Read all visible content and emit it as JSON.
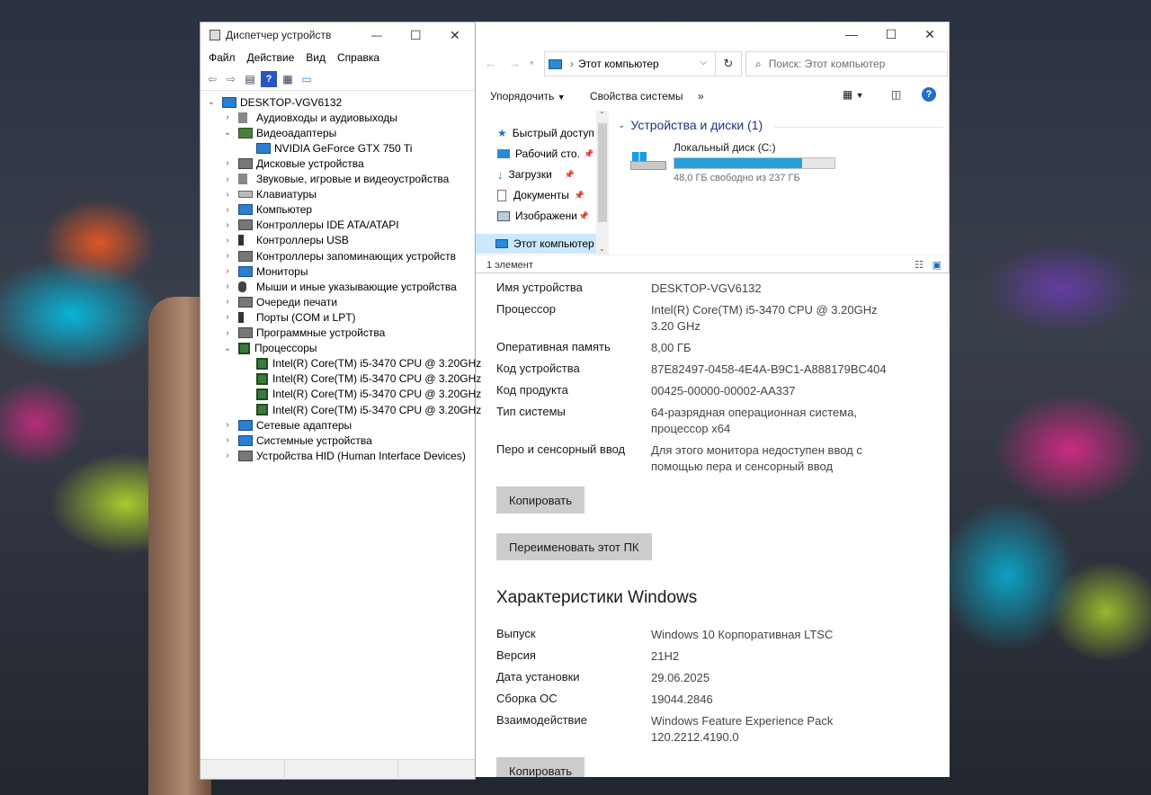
{
  "device_manager": {
    "title": "Диспетчер устройств",
    "menu": [
      "Файл",
      "Действие",
      "Вид",
      "Справка"
    ],
    "tree": [
      {
        "label": "DESKTOP-VGV6132",
        "level": 0,
        "expanded": true,
        "icon": "computer-icon"
      },
      {
        "label": "Аудиовходы и аудиовыходы",
        "level": 1,
        "expanded": false,
        "icon": "speaker-icon"
      },
      {
        "label": "Видеоадаптеры",
        "level": 1,
        "expanded": true,
        "icon": "display-adapter-icon"
      },
      {
        "label": "NVIDIA GeForce GTX 750 Ti",
        "level": 2,
        "icon": "gpu-icon"
      },
      {
        "label": "Дисковые устройства",
        "level": 1,
        "expanded": false,
        "icon": "disk-icon"
      },
      {
        "label": "Звуковые, игровые и видеоустройства",
        "level": 1,
        "expanded": false,
        "icon": "speaker-icon"
      },
      {
        "label": "Клавиатуры",
        "level": 1,
        "expanded": false,
        "icon": "keyboard-icon"
      },
      {
        "label": "Компьютер",
        "level": 1,
        "expanded": false,
        "icon": "monitor-icon"
      },
      {
        "label": "Контроллеры IDE ATA/ATAPI",
        "level": 1,
        "expanded": false,
        "icon": "controller-icon"
      },
      {
        "label": "Контроллеры USB",
        "level": 1,
        "expanded": false,
        "icon": "usb-icon"
      },
      {
        "label": "Контроллеры запоминающих устройств",
        "level": 1,
        "expanded": false,
        "icon": "storage-controller-icon"
      },
      {
        "label": "Мониторы",
        "level": 1,
        "expanded": false,
        "icon": "monitor-icon"
      },
      {
        "label": "Мыши и иные указывающие устройства",
        "level": 1,
        "expanded": false,
        "icon": "mouse-icon"
      },
      {
        "label": "Очереди печати",
        "level": 1,
        "expanded": false,
        "icon": "printer-icon"
      },
      {
        "label": "Порты (COM и LPT)",
        "level": 1,
        "expanded": false,
        "icon": "port-icon"
      },
      {
        "label": "Программные устройства",
        "level": 1,
        "expanded": false,
        "icon": "software-device-icon"
      },
      {
        "label": "Процессоры",
        "level": 1,
        "expanded": true,
        "icon": "cpu-icon"
      },
      {
        "label": "Intel(R) Core(TM) i5-3470 CPU @ 3.20GHz",
        "level": 2,
        "icon": "cpu-icon"
      },
      {
        "label": "Intel(R) Core(TM) i5-3470 CPU @ 3.20GHz",
        "level": 2,
        "icon": "cpu-icon"
      },
      {
        "label": "Intel(R) Core(TM) i5-3470 CPU @ 3.20GHz",
        "level": 2,
        "icon": "cpu-icon"
      },
      {
        "label": "Intel(R) Core(TM) i5-3470 CPU @ 3.20GHz",
        "level": 2,
        "icon": "cpu-icon"
      },
      {
        "label": "Сетевые адаптеры",
        "level": 1,
        "expanded": false,
        "icon": "network-icon"
      },
      {
        "label": "Системные устройства",
        "level": 1,
        "expanded": false,
        "icon": "system-device-icon"
      },
      {
        "label": "Устройства HID (Human Interface Devices)",
        "level": 1,
        "expanded": false,
        "icon": "hid-icon"
      }
    ]
  },
  "explorer": {
    "address": "Этот компьютер",
    "search_placeholder": "Поиск: Этот компьютер",
    "commands": {
      "organize": "Упорядочить",
      "system_properties": "Свойства системы",
      "more": "»"
    },
    "nav": [
      {
        "label": "Быстрый доступ",
        "icon": "star-icon",
        "pinned": false
      },
      {
        "label": "Рабочий сто.",
        "icon": "desktop-folder-icon",
        "pinned": true
      },
      {
        "label": "Загрузки",
        "icon": "downloads-icon",
        "pinned": true
      },
      {
        "label": "Документы",
        "icon": "documents-icon",
        "pinned": true
      },
      {
        "label": "Изображени",
        "icon": "pictures-icon",
        "pinned": true
      },
      {
        "label": "Этот компьютер",
        "icon": "this-pc-icon",
        "pinned": false,
        "selected": true
      }
    ],
    "group_title": "Устройства и диски (1)",
    "disk": {
      "name": "Локальный диск (C:)",
      "free_text": "48,0 ГБ свободно из 237 ГБ",
      "used_fraction": 0.8
    },
    "status": "1 элемент"
  },
  "system": {
    "device_rows": [
      {
        "key": "Имя устройства",
        "value": "DESKTOP-VGV6132"
      },
      {
        "key": "Процессор",
        "value": "Intel(R) Core(TM) i5-3470 CPU @ 3.20GHz 3.20 GHz"
      },
      {
        "key": "Оперативная память",
        "value": "8,00 ГБ"
      },
      {
        "key": "Код устройства",
        "value": "87E82497-0458-4E4A-B9C1-A888179BC404"
      },
      {
        "key": "Код продукта",
        "value": "00425-00000-00002-AA337"
      },
      {
        "key": "Тип системы",
        "value": "64-разрядная операционная система, процессор x64"
      },
      {
        "key": "Перо и сенсорный ввод",
        "value": "Для этого монитора недоступен ввод с помощью пера и сенсорный ввод"
      }
    ],
    "copy_label": "Копировать",
    "rename_label": "Переименовать этот ПК",
    "windows_heading": "Характеристики Windows",
    "windows_rows": [
      {
        "key": "Выпуск",
        "value": "Windows 10 Корпоративная LTSC"
      },
      {
        "key": "Версия",
        "value": "21H2"
      },
      {
        "key": "Дата установки",
        "value": "29.06.2025"
      },
      {
        "key": "Сборка ОС",
        "value": "19044.2846"
      },
      {
        "key": "Взаимодействие",
        "value": "Windows Feature Experience Pack 120.2212.4190.0"
      }
    ],
    "copy2_label": "Копировать"
  }
}
